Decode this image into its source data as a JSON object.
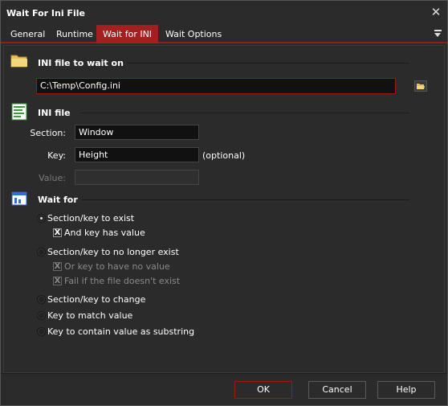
{
  "window": {
    "title": "Wait For Ini File",
    "close_glyph": "✕"
  },
  "tabs": [
    {
      "label": "General",
      "active": false
    },
    {
      "label": "Runtime",
      "active": false
    },
    {
      "label": "Wait for INI",
      "active": true
    },
    {
      "label": "Wait Options",
      "active": false
    }
  ],
  "ini_file_to_wait_on": {
    "heading": "INI file to wait on",
    "icon": "folder-icon",
    "path_value": "C:\\Temp\\Config.ini",
    "browse_icon": "open-folder-icon"
  },
  "ini_file": {
    "heading": "INI file",
    "icon": "document-icon",
    "section_label": "Section:",
    "section_value": "Window",
    "key_label": "Key:",
    "key_value": "Height",
    "key_hint": "(optional)",
    "value_label": "Value:",
    "value_value": ""
  },
  "wait_for": {
    "heading": "Wait for",
    "icon": "window-icon",
    "options": [
      {
        "label": "Section/key to exist",
        "checked": true
      },
      {
        "label": "Section/key to no longer exist",
        "checked": false
      },
      {
        "label": "Section/key to change",
        "checked": false
      },
      {
        "label": "Key to match value",
        "checked": false
      },
      {
        "label": "Key to contain value as substring",
        "checked": false
      }
    ],
    "and_key_has_value": {
      "label": "And key has value",
      "checked": true,
      "enabled": true
    },
    "or_key_to_have_no_value": {
      "label": "Or key to have no value",
      "checked": true,
      "enabled": false
    },
    "fail_if_file_doesnt_exist": {
      "label": "Fail if the file doesn't exist",
      "checked": true,
      "enabled": false
    }
  },
  "footer": {
    "ok_label": "OK",
    "cancel_label": "Cancel",
    "help_label": "Help"
  },
  "colors": {
    "accent": "#a41f1f",
    "background": "#2b2b2b",
    "field": "#111111"
  }
}
